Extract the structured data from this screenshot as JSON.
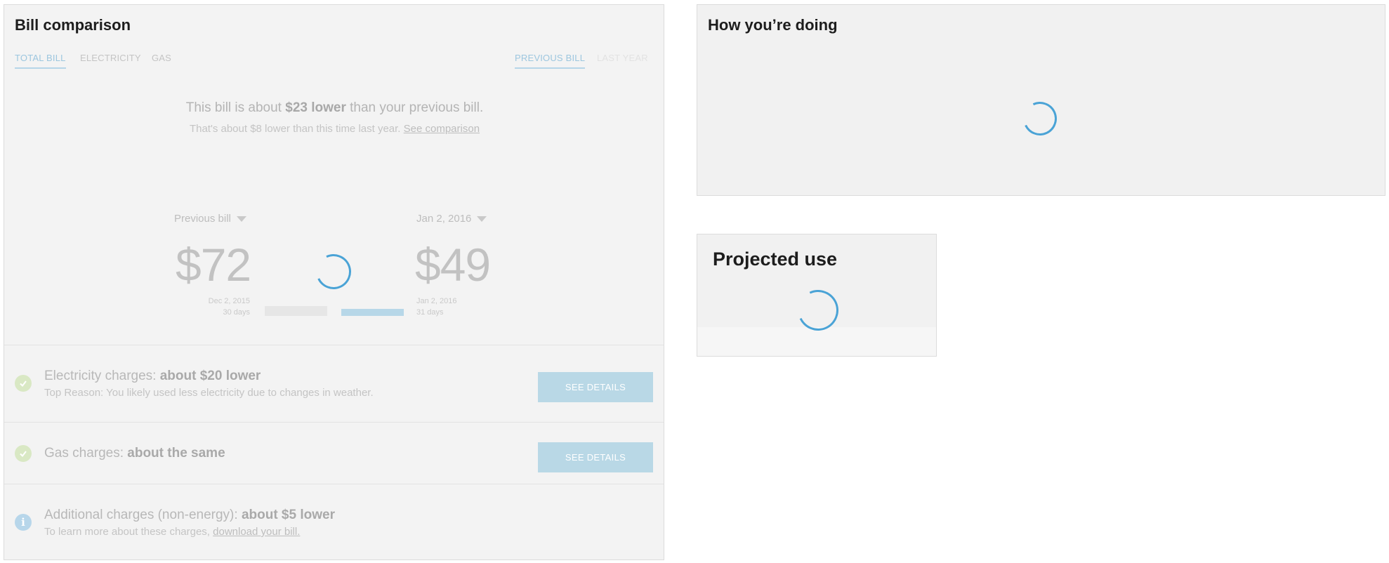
{
  "bill_comparison": {
    "title": "Bill comparison",
    "tabs_left": [
      "TOTAL BILL",
      "ELECTRICITY",
      "GAS"
    ],
    "tabs_right": [
      "PREVIOUS BILL",
      "LAST YEAR"
    ],
    "active_left": "TOTAL BILL",
    "active_right": "PREVIOUS BILL",
    "summary": {
      "prefix": "This bill is about ",
      "amount": "$23 lower",
      "suffix": " than your previous bill.",
      "sub_text": "That's about $8 lower than this time last year. ",
      "sub_link": "See comparison"
    },
    "previous": {
      "selector": "Previous bill",
      "amount": "$72",
      "date": "Dec 2, 2015",
      "days": "30 days"
    },
    "current": {
      "selector": "Jan 2, 2016",
      "amount": "$49",
      "date": "Jan 2, 2016",
      "days": "31 days"
    },
    "breakdown": [
      {
        "icon": "check-circle-icon",
        "label": "Electricity charges: ",
        "value": "about $20 lower",
        "sub": "Top Reason: You likely used less electricity due to changes in weather.",
        "button": "SEE DETAILS"
      },
      {
        "icon": "check-circle-icon",
        "label": "Gas charges: ",
        "value": "about the same",
        "button": "SEE DETAILS"
      },
      {
        "icon": "info-icon",
        "label": "Additional charges (non-energy): ",
        "value": "about $5 lower",
        "sub_text": "To learn more about these charges, ",
        "sub_link": "download your bill."
      }
    ]
  },
  "how_doing": {
    "title": "How you’re doing"
  },
  "projected_use": {
    "title": "Projected use"
  },
  "colors": {
    "accent": "#4aa3d6",
    "button": "#b9d8e6",
    "check": "#d9e8c4"
  }
}
